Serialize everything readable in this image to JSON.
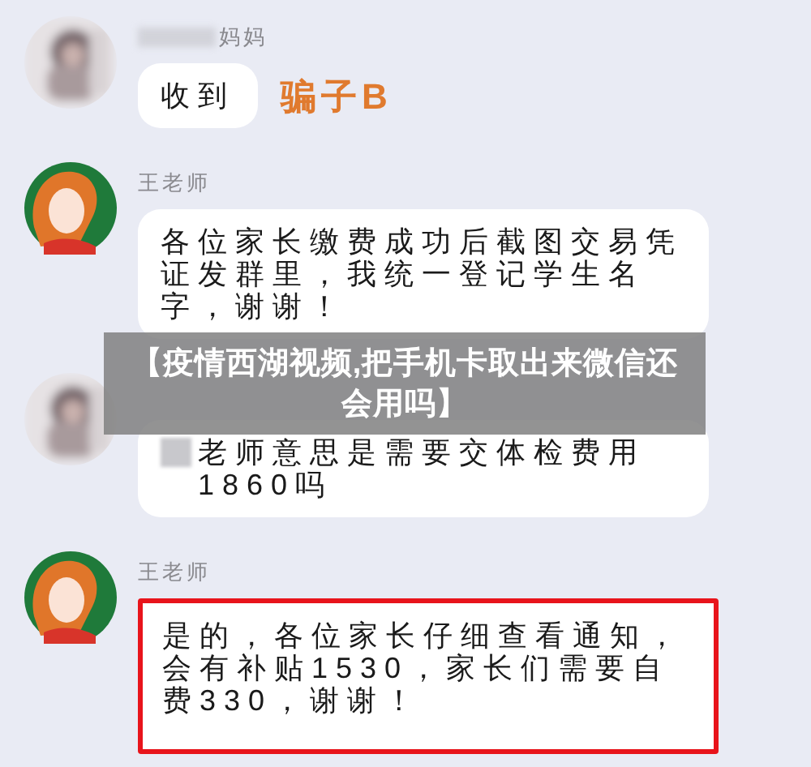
{
  "messages": [
    {
      "sender": "妈妈",
      "sender_prefix_blurred": true,
      "text": "收到",
      "text_prefix_blurred": false,
      "annotation": "骗子B",
      "highlighted": false
    },
    {
      "avatar": {
        "kind": "cartoon"
      },
      "sender": "王老师",
      "sender_prefix_blurred": false,
      "text": "各位家长缴费成功后截图交易凭证发群里，我统一登记学生名字，谢谢！",
      "text_prefix_blurred": false,
      "highlighted": false
    },
    {
      "text": "老师意思是需要交体检费用1860吗",
      "text_prefix_blurred": true,
      "highlighted": false
    },
    {
      "avatar": {
        "kind": "cartoon"
      },
      "sender": "王老师",
      "sender_prefix_blurred": false,
      "text": "是的，各位家长仔细查看通知，会有补贴1530，家长们需要自费330，谢谢！",
      "text_prefix_blurred": false,
      "highlighted": true
    }
  ],
  "caption_banner": {
    "text": "【疫情西湖视频,把手机卡取出来微信还会用吗】"
  }
}
